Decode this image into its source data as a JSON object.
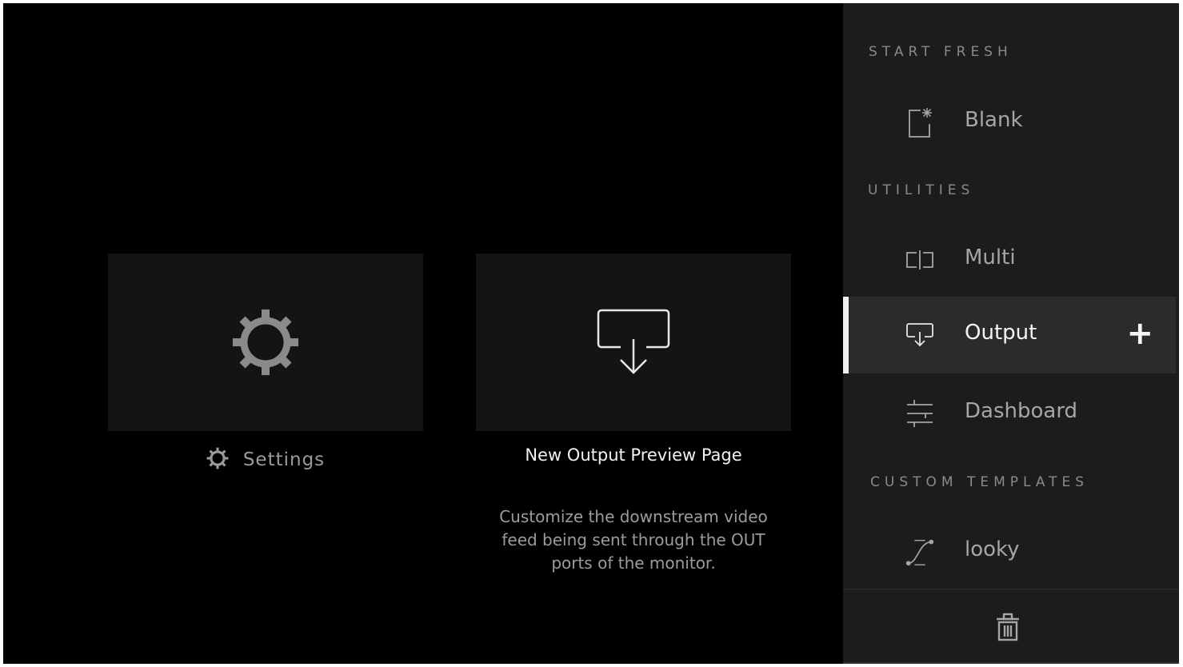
{
  "colors": {
    "background": "#000000",
    "card": "#141414",
    "sidebar": "#1c1c1c",
    "active_item": "#2b2b2b",
    "accent": "#f0f0f0"
  },
  "cards": {
    "settings": {
      "label": "Settings",
      "icon": "gear-icon"
    },
    "output": {
      "icon": "output-download-icon",
      "title": "New Output Preview Page",
      "description": "Customize the downstream video feed being sent through the OUT ports of the monitor."
    }
  },
  "sidebar": {
    "sections": {
      "start_fresh": "START FRESH",
      "utilities": "UTILITIES",
      "custom_templates": "CUSTOM TEMPLATES"
    },
    "items": {
      "blank": {
        "label": "Blank",
        "icon": "blank-page-icon"
      },
      "multi": {
        "label": "Multi",
        "icon": "split-view-icon"
      },
      "output": {
        "label": "Output",
        "icon": "output-icon",
        "active": true,
        "action": "+"
      },
      "dashboard": {
        "label": "Dashboard",
        "icon": "sliders-icon"
      },
      "looky": {
        "label": "looky",
        "icon": "curve-icon"
      }
    },
    "trash_icon": "trash-icon"
  }
}
